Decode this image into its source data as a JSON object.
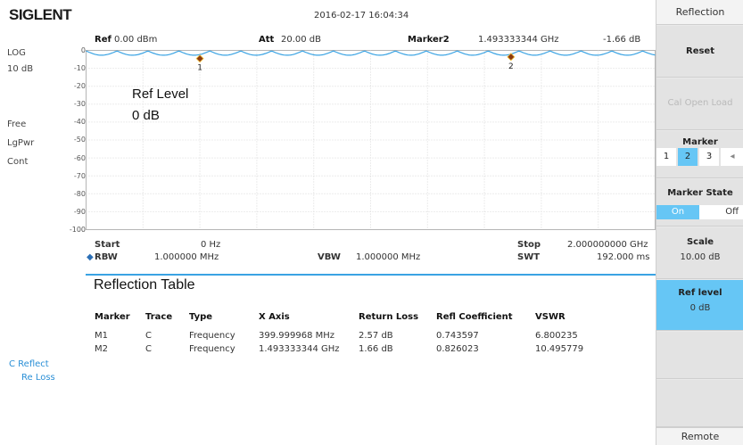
{
  "header": {
    "brand": "SIGLENT",
    "datetime": "2016-02-17  16:04:34",
    "ref": {
      "label": "Ref",
      "value": "0.00 dBm"
    },
    "att": {
      "label": "Att",
      "value": "20.00 dB"
    },
    "marker": {
      "label": "Marker2",
      "freq": "1.493333344 GHz",
      "level": "-1.66 dB"
    }
  },
  "left_status": [
    "LOG",
    "10 dB",
    "Free",
    "LgPwr",
    "Cont"
  ],
  "y_axis": [
    "0",
    "-10",
    "-20",
    "-30",
    "-40",
    "-50",
    "-60",
    "-70",
    "-80",
    "-90",
    "-100"
  ],
  "overlay": {
    "ref_level_label": "Ref Level",
    "ref_level_value": "0 dB"
  },
  "footer": {
    "start_label": "Start",
    "start_value": "0 Hz",
    "stop_label": "Stop",
    "stop_value": "2.000000000 GHz",
    "rbw_label": "RBW",
    "rbw_value": "1.000000 MHz",
    "vbw_label": "VBW",
    "vbw_value": "1.000000 MHz",
    "swt_label": "SWT",
    "swt_value": "192.000 ms"
  },
  "table": {
    "title": "Reflection Table",
    "columns": [
      "Marker",
      "Trace",
      "Type",
      "X Axis",
      "Return Loss",
      "Refl Coefficient",
      "VSWR"
    ],
    "rows": [
      [
        "M1",
        "C",
        "Frequency",
        "399.999968 MHz",
        "2.57 dB",
        "0.743597",
        "6.800235"
      ],
      [
        "M2",
        "C",
        "Frequency",
        "1.493333344 GHz",
        "1.66 dB",
        "0.826023",
        "10.495779"
      ]
    ]
  },
  "trace_label": {
    "line1": "C Reflect",
    "line2": "Re Loss"
  },
  "softkeys": {
    "title": "Reflection",
    "reset": "Reset",
    "cal_open_load": "Cal Open Load",
    "marker": "Marker",
    "marker_options": [
      "1",
      "2",
      "3"
    ],
    "marker_selected": "2",
    "marker_state": "Marker State",
    "state_on": "On",
    "state_off": "Off",
    "scale": "Scale",
    "scale_value": "10.00 dB",
    "ref_level": "Ref level",
    "ref_level_value": "0 dB",
    "remote": "Remote"
  },
  "markers": [
    {
      "label": "1",
      "freq_ghz": 0.4,
      "level_db": -2.57
    },
    {
      "label": "2",
      "freq_ghz": 1.4933,
      "level_db": -1.66
    }
  ],
  "colors": {
    "trace": "#3aa3e3",
    "marker": "#8b3a0f",
    "accent": "#66c6f5"
  }
}
